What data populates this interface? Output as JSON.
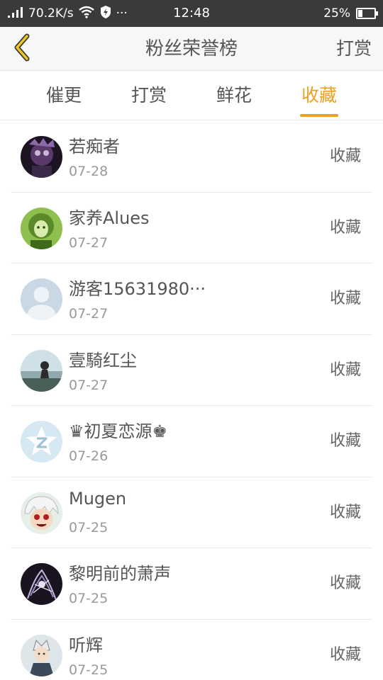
{
  "status_bar": {
    "signal": ".ıll",
    "speed": "70.2K/s",
    "more": "···",
    "time": "12:48",
    "battery_text": "25%",
    "battery_level": 0.25
  },
  "header": {
    "title": "粉丝荣誉榜",
    "action": "打赏"
  },
  "tabs": [
    {
      "label": "催更",
      "active": false
    },
    {
      "label": "打赏",
      "active": false
    },
    {
      "label": "鲜花",
      "active": false
    },
    {
      "label": "收藏",
      "active": true
    }
  ],
  "colors": {
    "accent": "#f0a01e",
    "status_bar_bg": "#3a3a3a"
  },
  "fans": [
    {
      "name": "若痴者",
      "date": "07-28",
      "action": "收藏",
      "avatar": "dark-purple-mask"
    },
    {
      "name": "家养Alues",
      "date": "07-27",
      "action": "收藏",
      "avatar": "green-anime"
    },
    {
      "name": "游客15631980···",
      "date": "07-27",
      "action": "收藏",
      "avatar": "default-person"
    },
    {
      "name": "壹騎红尘",
      "date": "07-27",
      "action": "收藏",
      "avatar": "dusk-landscape"
    },
    {
      "name": "♛初夏恋源♚",
      "date": "07-26",
      "action": "收藏",
      "avatar": "qzone-star"
    },
    {
      "name": "Mugen",
      "date": "07-25",
      "action": "收藏",
      "avatar": "anime-girl-white-hair"
    },
    {
      "name": "黎明前的萧声",
      "date": "07-25",
      "action": "收藏",
      "avatar": "dark-fantasy"
    },
    {
      "name": "听辉",
      "date": "07-25",
      "action": "收藏",
      "avatar": "anime-character"
    }
  ]
}
